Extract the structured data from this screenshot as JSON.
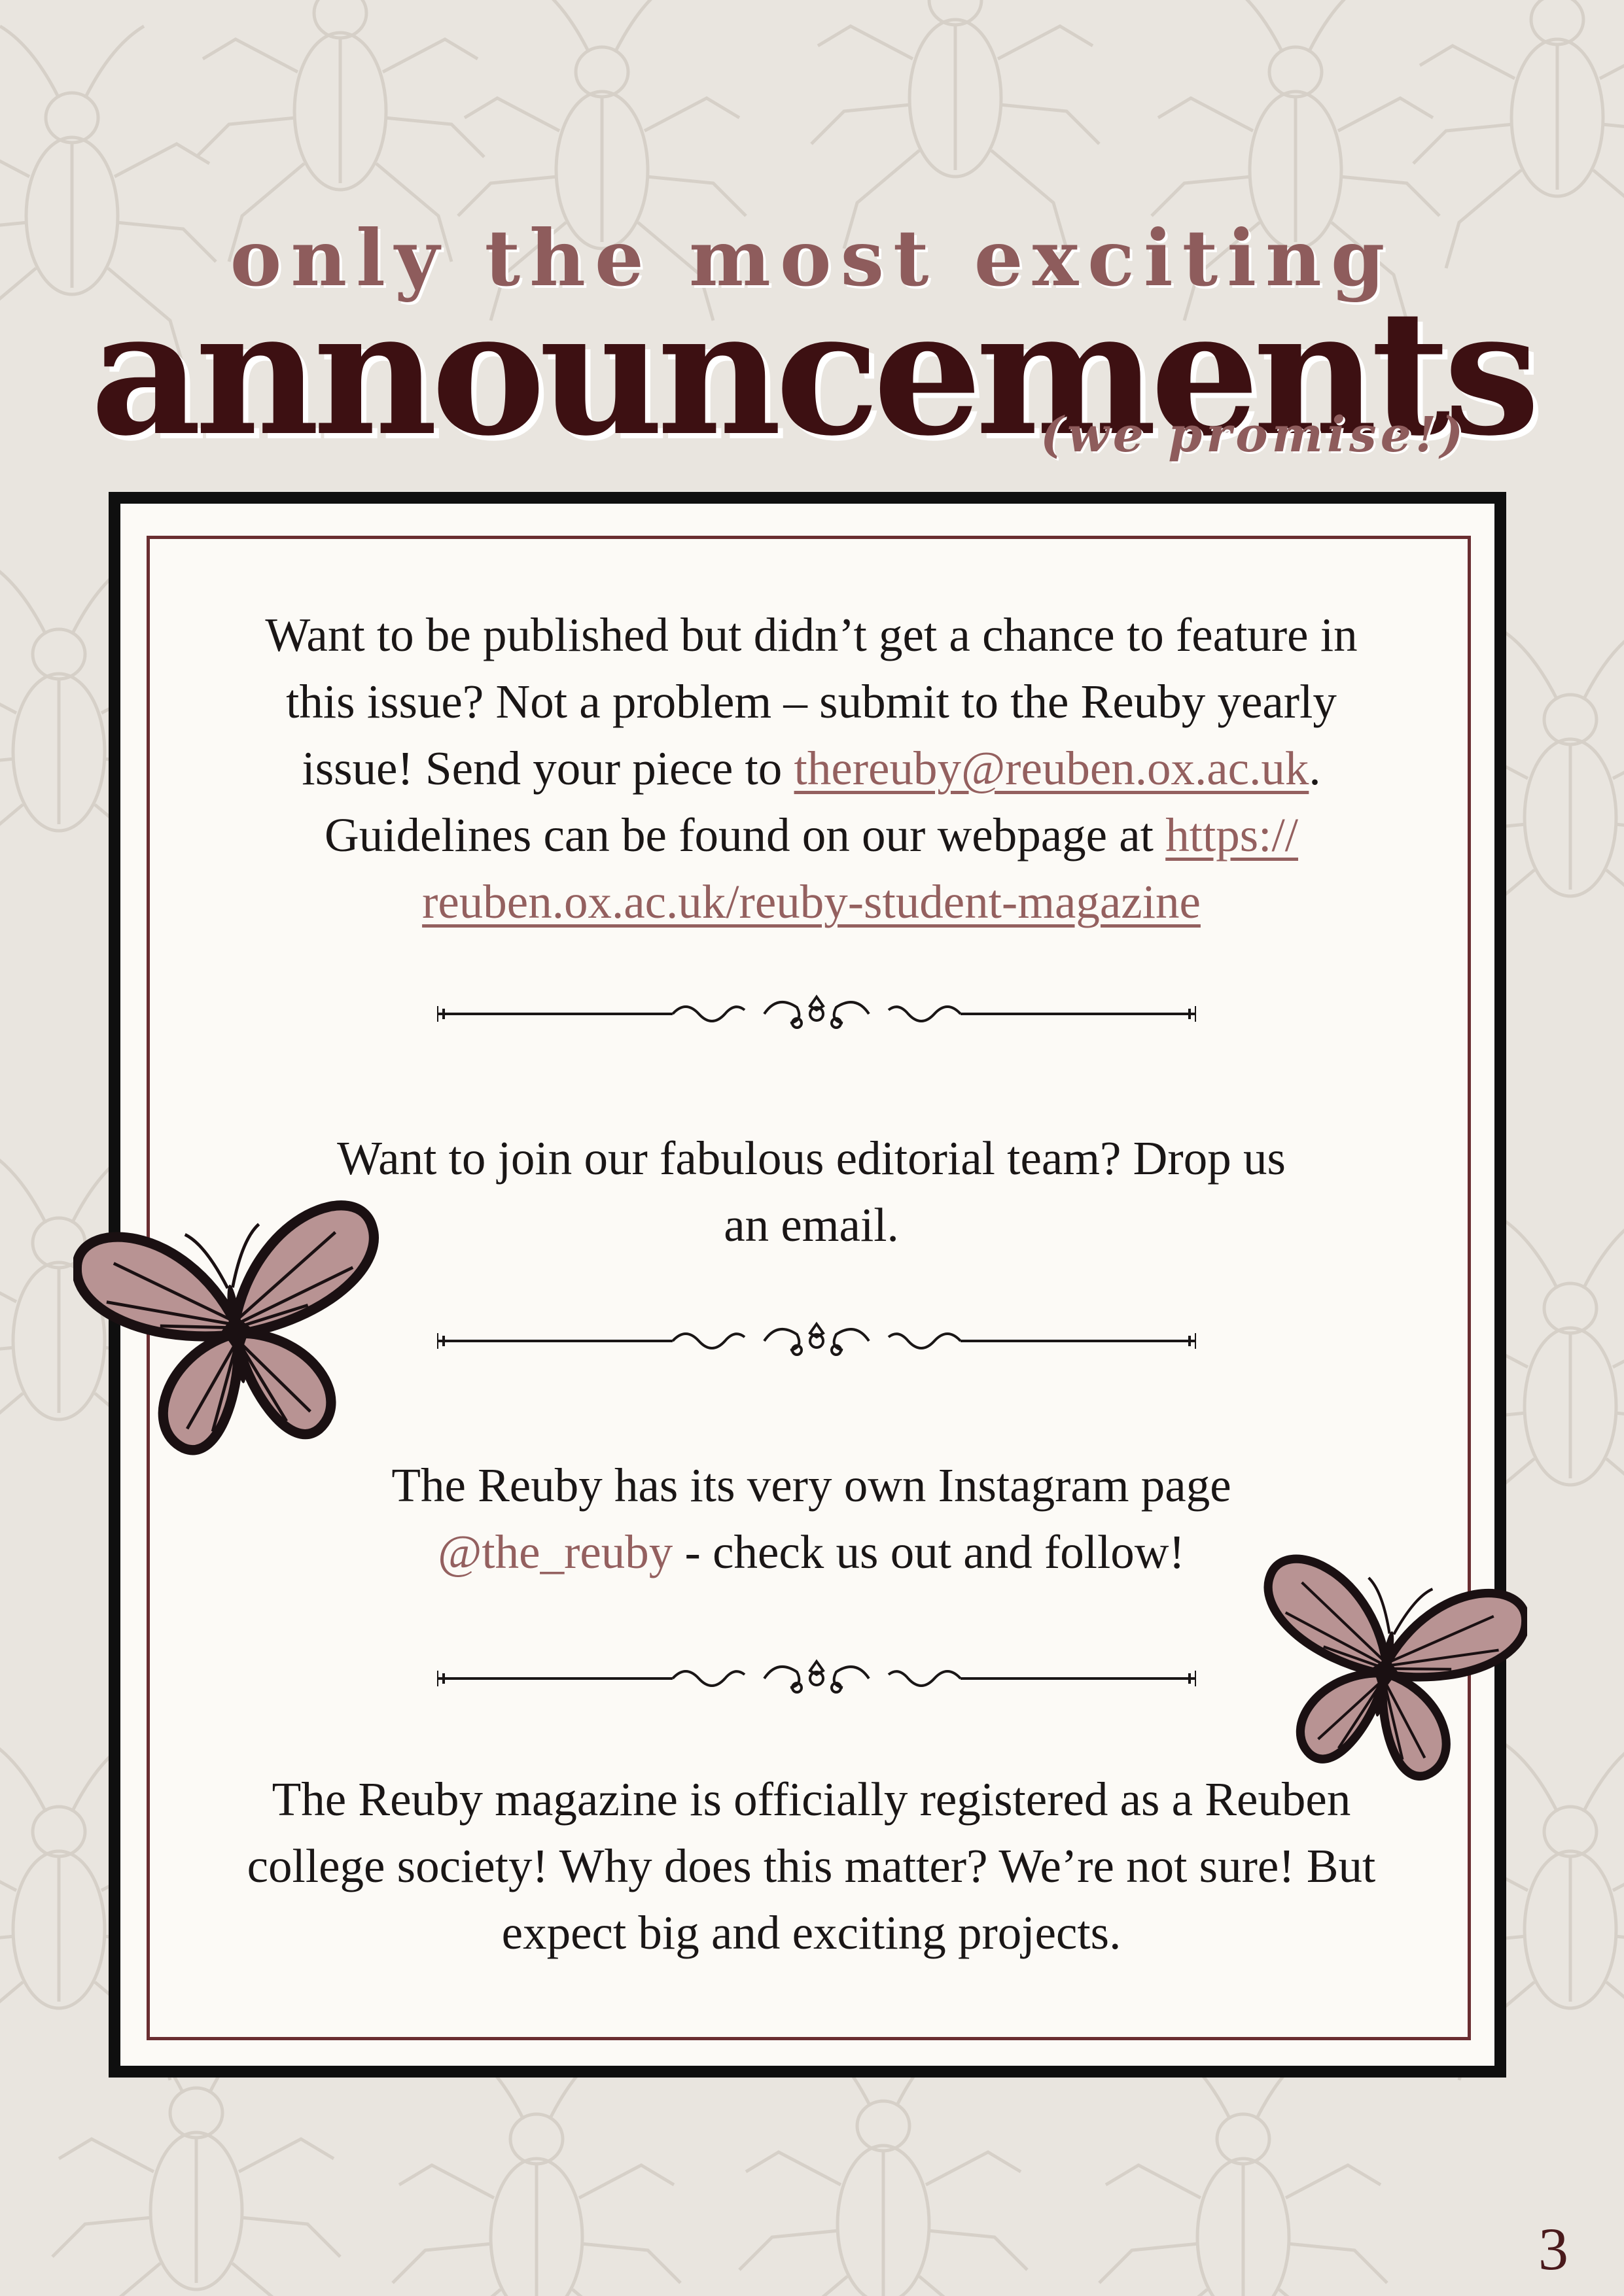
{
  "header": {
    "kicker": "only the most exciting",
    "title": "announcements",
    "subtitle": "(we promise!)"
  },
  "sections": {
    "submit": {
      "line1": "Want to be published but didn’t get a chance to feature in",
      "line2": "this issue? Not a problem – submit to the Reuby yearly",
      "line3_before": "issue! Send your piece to ",
      "email": "thereuby@reuben.ox.ac.uk",
      "line3_after": ".",
      "line4_before": "Guidelines can be found on our webpage at ",
      "url_part1": "https://",
      "url_part2": "reuben.ox.ac.uk/reuby-student-magazine "
    },
    "editorial": {
      "line1": "Want to join our fabulous editorial team? Drop us",
      "line2": "an email."
    },
    "instagram": {
      "line1": "The Reuby has its very own Instagram page",
      "handle": "@the_reuby",
      "line2_after": " - check us out and follow!"
    },
    "society": {
      "line1": "The Reuby magazine is officially registered as a Reuben",
      "line2": "college society! Why does this matter? We’re not sure! But",
      "line3": "expect big and exciting projects."
    }
  },
  "page_number": "3",
  "icons": [
    "ornamental-divider-icon",
    "butterfly-icon",
    "beetle-pattern"
  ],
  "colors": {
    "background": "#e9e5df",
    "accent": "#8e5c5c",
    "title": "#3d1012",
    "frame": "#0f0f0f",
    "inner_border": "#6a2e31",
    "panel": "#fcfaf6"
  }
}
